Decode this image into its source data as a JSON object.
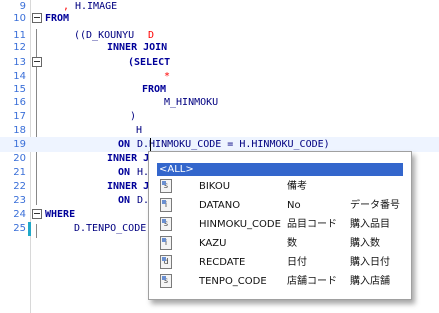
{
  "editor": {
    "lines": [
      {
        "n": "9"
      },
      {
        "n": "10"
      },
      {
        "n": "11"
      },
      {
        "n": "12"
      },
      {
        "n": "13"
      },
      {
        "n": "14"
      },
      {
        "n": "15"
      },
      {
        "n": "16"
      },
      {
        "n": "17"
      },
      {
        "n": "18"
      },
      {
        "n": "19"
      },
      {
        "n": "20"
      },
      {
        "n": "21"
      },
      {
        "n": "22"
      },
      {
        "n": "23"
      },
      {
        "n": "24"
      },
      {
        "n": "25"
      }
    ],
    "tokens": {
      "l9_comma": ",",
      "l9_ident": "H.IMAGE",
      "l10_kw": "FROM",
      "l11_paren": "((D_KOUNYU",
      "l11_alias": "D",
      "l12_kw": "INNER JOIN",
      "l13_kw": "(SELECT",
      "l14_star": "*",
      "l15_kw": "FROM",
      "l16_ident": "M_HINMOKU",
      "l17_paren": ")",
      "l18_alias": "H",
      "l19_kw": "ON",
      "l19_expr": "D.HINMOKU_CODE = H.HINMOKU_CODE)",
      "l20_kw": "INNER J",
      "l21_kw": "ON",
      "l21_expr": "H.",
      "l22_kw": "INNER J",
      "l23_kw": "ON",
      "l23_expr": "D.",
      "l24_kw": "WHERE",
      "l25_expr": "D.TENPO_CODE"
    }
  },
  "popup": {
    "header": "<ALL>",
    "items": [
      {
        "icon": "string-column-icon",
        "name": "BIKOU",
        "jp1": "備考",
        "jp2": ""
      },
      {
        "icon": "integer-column-icon",
        "name": "DATANO",
        "jp1": "No",
        "jp2": "データ番号"
      },
      {
        "icon": "string-column-icon",
        "name": "HINMOKU_CODE",
        "jp1": "品目コード",
        "jp2": "購入品目"
      },
      {
        "icon": "integer-column-icon",
        "name": "KAZU",
        "jp1": "数",
        "jp2": "購入数"
      },
      {
        "icon": "date-column-icon",
        "name": "RECDATE",
        "jp1": "日付",
        "jp2": "購入日付"
      },
      {
        "icon": "string-column-icon",
        "name": "TENPO_CODE",
        "jp1": "店舗コード",
        "jp2": "購入店舗"
      }
    ]
  }
}
